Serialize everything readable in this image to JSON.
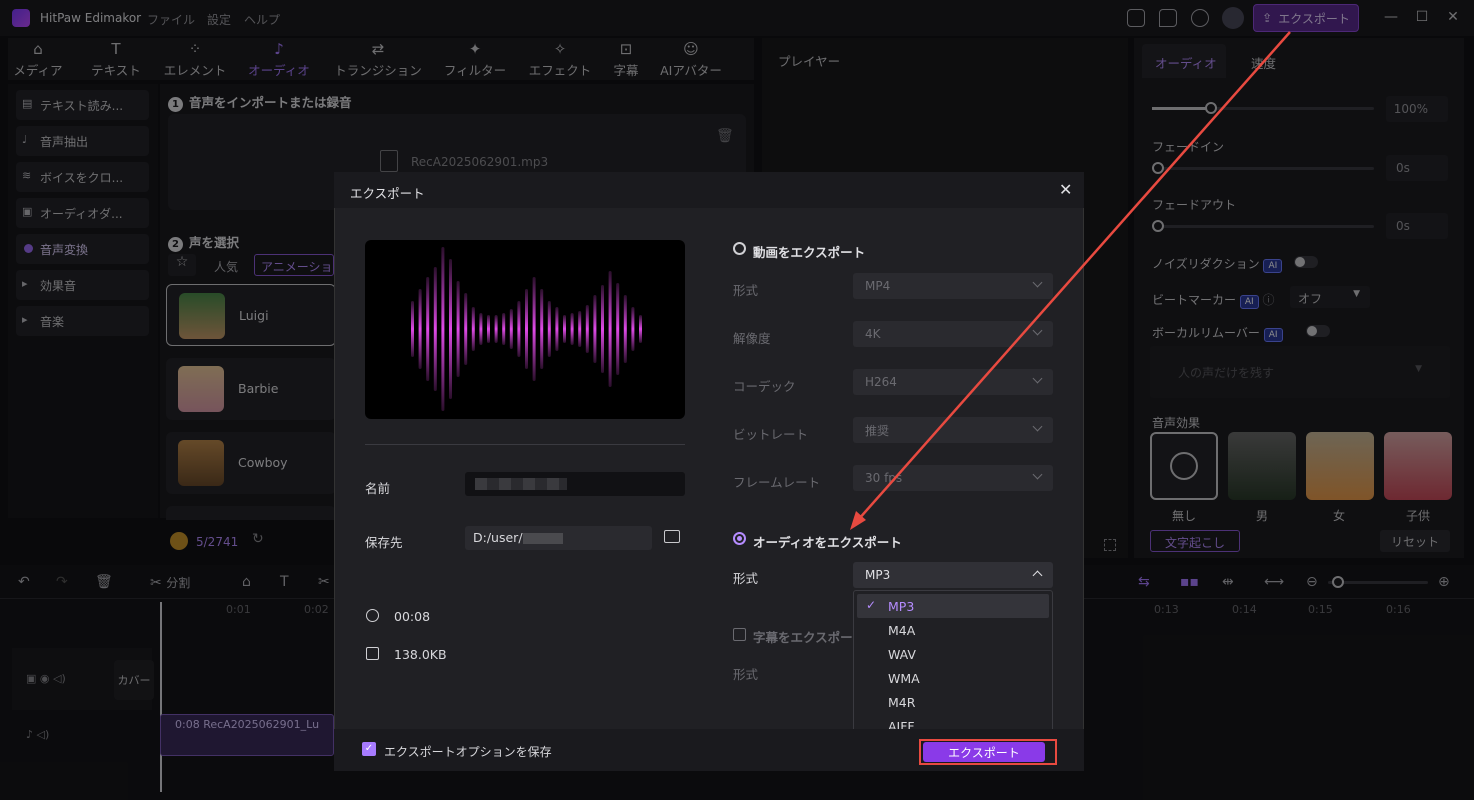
{
  "app": {
    "title": "HitPaw Edimakor",
    "menu": [
      "ファイル",
      "設定",
      "ヘルプ"
    ],
    "export_label": "エクスポート"
  },
  "tabs": [
    {
      "label": "メディア",
      "icon": "media-icon"
    },
    {
      "label": "テキスト",
      "icon": "text-icon"
    },
    {
      "label": "エレメント",
      "icon": "element-icon"
    },
    {
      "label": "オーディオ",
      "icon": "audio-icon",
      "active": true
    },
    {
      "label": "トランジション",
      "icon": "transition-icon"
    },
    {
      "label": "フィルター",
      "icon": "filter-icon"
    },
    {
      "label": "エフェクト",
      "icon": "effect-icon"
    },
    {
      "label": "字幕",
      "icon": "subtitle-icon"
    },
    {
      "label": "AIアバター",
      "icon": "avatar-icon"
    }
  ],
  "sidebar": {
    "items": [
      "テキスト読み...",
      "音声抽出",
      "ボイスをクロ...",
      "オーディオダ...",
      "音声変換",
      "効果音",
      "音楽"
    ]
  },
  "audio_panel": {
    "step1": "音声をインポートまたは録音",
    "file": "RecA2025062901.mp3",
    "step2": "声を選択",
    "filters": [
      "人気",
      "アニメーショ"
    ],
    "voices": [
      "Luigi",
      "Barbie",
      "Cowboy"
    ],
    "credits": "5/2741"
  },
  "player": {
    "title": "プレイヤー"
  },
  "right_panel": {
    "tabs": [
      "オーディオ",
      "速度"
    ],
    "volume": "100%",
    "fade_in": "フェードイン",
    "fade_in_val": "0s",
    "fade_out": "フェードアウト",
    "fade_out_val": "0s",
    "noise": "ノイズリダクション",
    "beat": "ビートマーカー",
    "beat_val": "オフ",
    "vocal": "ボーカルリムーバー",
    "vocal_placeholder": "人の声だけを残す",
    "effects_title": "音声効果",
    "effects": [
      "無し",
      "男",
      "女",
      "子供"
    ],
    "ai_badge": "AI",
    "transcribe": "文字起こし",
    "reset": "リセット"
  },
  "timeline": {
    "split": "分割",
    "ticks": [
      "0:01",
      "0:02",
      "0:13",
      "0:14",
      "0:15",
      "0:16"
    ],
    "cover": "カバー",
    "clip": "0:08 RecA2025062901_Lu"
  },
  "dialog": {
    "title": "エクスポート",
    "name_label": "名前",
    "save_label": "保存先",
    "save_path": "D:/user/",
    "duration": "00:08",
    "size": "138.0KB",
    "video_export": "動画をエクスポート",
    "format": "形式",
    "format_val": "MP4",
    "resolution": "解像度",
    "resolution_val": "4K",
    "codec": "コーデック",
    "codec_val": "H264",
    "bitrate": "ビットレート",
    "bitrate_val": "推奨",
    "framerate": "フレームレート",
    "framerate_val": "30 fps",
    "audio_export": "オーディオをエクスポート",
    "audio_format": "形式",
    "audio_format_val": "MP3",
    "subtitle_export": "字幕をエクスポー",
    "subtitle_format": "形式",
    "options": [
      "MP3",
      "M4A",
      "WAV",
      "WMA",
      "M4R",
      "AIFF"
    ],
    "save_options": "エクスポートオプションを保存",
    "export_button": "エクスポート"
  },
  "colors": {
    "accent": "#a77bff",
    "annotation": "#e84a40"
  }
}
